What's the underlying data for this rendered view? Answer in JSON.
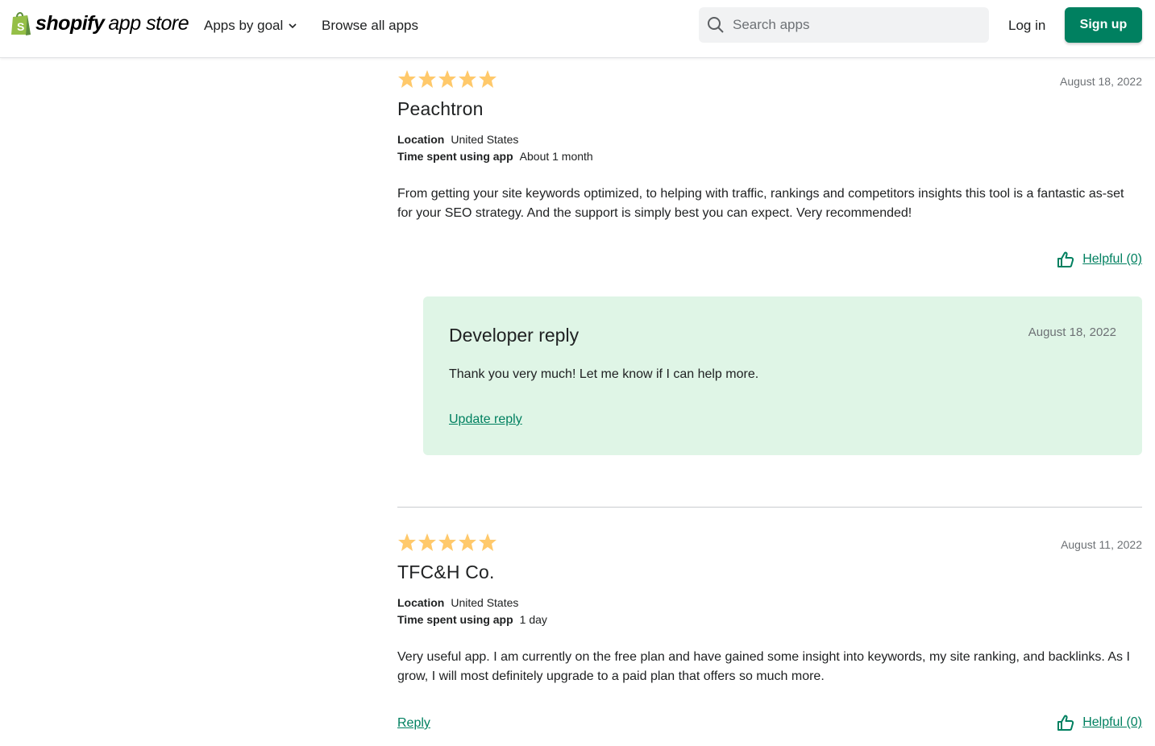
{
  "header": {
    "logo_brand": "shopify",
    "logo_rest": "app store",
    "nav": [
      {
        "label": "Apps by goal",
        "icon": "chevron-down-icon"
      },
      {
        "label": "Browse all apps"
      }
    ],
    "search_placeholder": "Search apps",
    "login_label": "Log in",
    "signup_label": "Sign up"
  },
  "colors": {
    "accent": "#008060",
    "star": "#ffc96b",
    "reply_bg": "#dff5e6"
  },
  "reviews": [
    {
      "rating": 5,
      "date": "August 18, 2022",
      "author": "Peachtron",
      "location_label": "Location",
      "location": "United States",
      "time_label": "Time spent using app",
      "time": "About 1 month",
      "text": "From getting your site keywords optimized, to helping with traffic, rankings and competitors insights this tool is a fantastic as-set for your SEO strategy. And the support is simply best you can expect. Very recommended!",
      "helpful": "Helpful (0)",
      "developer_reply": {
        "title": "Developer reply",
        "date": "August 18, 2022",
        "text": "Thank you very much! Let me know if I can help more.",
        "action": "Update reply"
      }
    },
    {
      "rating": 5,
      "date": "August 11, 2022",
      "author": "TFC&H Co.",
      "location_label": "Location",
      "location": "United States",
      "time_label": "Time spent using app",
      "time": "1 day",
      "text": "Very useful app. I am currently on the free plan and have gained some insight into keywords, my site ranking, and backlinks. As I grow, I will most definitely upgrade to a paid plan that offers so much more.",
      "reply_label": "Reply",
      "helpful": "Helpful (0)"
    }
  ]
}
